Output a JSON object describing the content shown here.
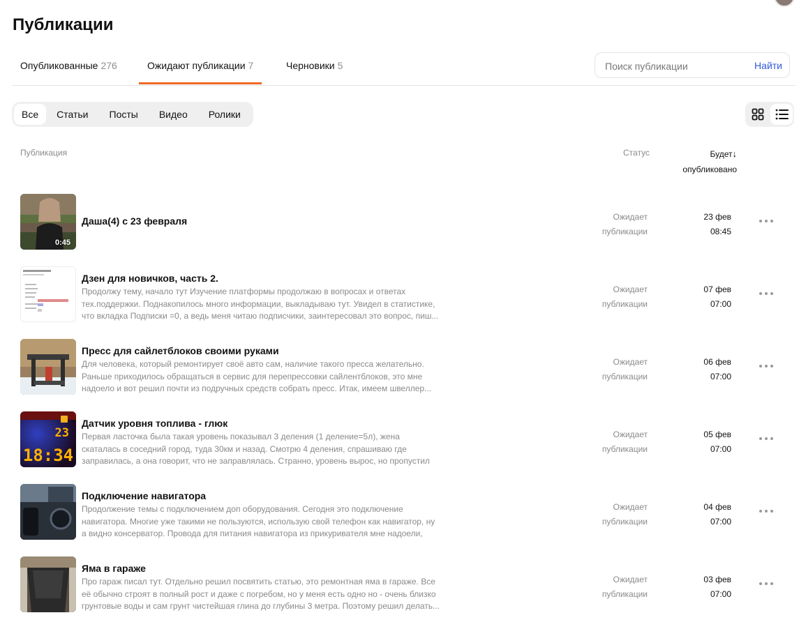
{
  "page": {
    "title": "Публикации"
  },
  "tabs": [
    {
      "label": "Опубликованные",
      "count": "276"
    },
    {
      "label": "Ожидают публикации",
      "count": "7"
    },
    {
      "label": "Черновики",
      "count": "5"
    }
  ],
  "search": {
    "placeholder": "Поиск публикации",
    "button": "Найти"
  },
  "filters": [
    "Все",
    "Статьи",
    "Посты",
    "Видео",
    "Ролики"
  ],
  "view": {
    "grid_icon": "grid-view-icon",
    "list_icon": "list-view-icon",
    "active": "list"
  },
  "table_header": {
    "publication": "Публикация",
    "status": "Статус",
    "date_line1": "Будет",
    "date_arrow": "↓",
    "date_line2": "опубликовано"
  },
  "rows": [
    {
      "title": "Даша(4) с 23 февраля",
      "desc": "",
      "duration": "0:45",
      "status_1": "Ожидает",
      "status_2": "публикации",
      "date": "23 фев",
      "time": "08:45"
    },
    {
      "title": "Дзен для новичков, часть 2.",
      "desc": "Продолжу тему, начало тут Изучение платформы продолжаю в вопросах и ответах тех.поддержки. Поднакопилось много информации, выкладываю тут. Увидел в статистике, что вкладка Подписки =0, а ведь меня читаю подписчики, заинтересовал это вопрос, пиш...",
      "duration": "",
      "status_1": "Ожидает",
      "status_2": "публикации",
      "date": "07 фев",
      "time": "07:00"
    },
    {
      "title": "Пресс для сайлетблоков своими руками",
      "desc": "Для человека, который ремонтирует своё авто сам, наличие такого пресса желательно. Раньше приходилось обращаться в сервис для перепрессовки сайлентблоков, это мне надоело и вот решил почти из подручных средств собрать пресс. Итак, имеем швеллер...",
      "duration": "",
      "status_1": "Ожидает",
      "status_2": "публикации",
      "date": "06 фев",
      "time": "07:00"
    },
    {
      "title": "Датчик уровня топлива - глюк",
      "desc": "Первая ласточка была такая уровень показывал 3 деления (1 деление=5л), жена скаталась в соседний город, туда 30км и назад. Смотрю 4 деления, спрашиваю где заправилась, а она говорит, что не заправлялась. Странно, уровень вырос, но пропустил мимо... Спустя врем...",
      "duration": "",
      "status_1": "Ожидает",
      "status_2": "публикации",
      "date": "05 фев",
      "time": "07:00"
    },
    {
      "title": "Подключение навигатора",
      "desc": "Продолжение темы с подключением доп оборудования. Сегодня это подключение навигатора. Многие уже такими не пользуются, использую свой телефон как навигатор, ну а видно консерватор. Провода для питания навигатора из прикуривателя мне надоели, да...",
      "duration": "",
      "status_1": "Ожидает",
      "status_2": "публикации",
      "date": "04 фев",
      "time": "07:00"
    },
    {
      "title": "Яма в гараже",
      "desc": "Про гараж писал тут. Отдельно решил посвятить статью, это ремонтная яма в гараже. Все её обычно строят в полный рост и даже с погребом, но у меня есть одно но - очень близко грунтовые воды и сам грунт чистейшая глина до глубины 3 метра. Поэтому решил делать...",
      "duration": "",
      "status_1": "Ожидает",
      "status_2": "публикации",
      "date": "03 фев",
      "time": "07:00"
    }
  ],
  "thumb_displays": {
    "fuel_level": "23",
    "clock": "18:34"
  },
  "colors": {
    "accent": "#f06a25",
    "link": "#2f5bd6",
    "muted": "#8a8a8a"
  }
}
